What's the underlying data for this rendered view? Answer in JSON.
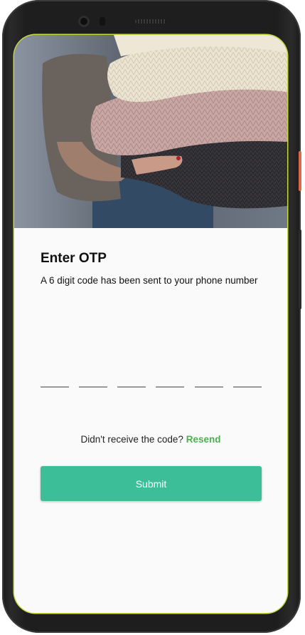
{
  "screen": {
    "title": "Enter OTP",
    "subtitle": "A 6 digit code has been sent to your phone number",
    "otp": {
      "digits": [
        "",
        "",
        "",
        "",
        "",
        ""
      ]
    },
    "resend_prompt": "Didn't receive the code?",
    "resend_link": "Resend",
    "submit_label": "Submit"
  },
  "colors": {
    "accent": "#3cbf98",
    "link": "#4caf50",
    "screen_border": "#c6d93a"
  },
  "hero_image": {
    "subject": "person holding stack of folded knit sweaters"
  }
}
